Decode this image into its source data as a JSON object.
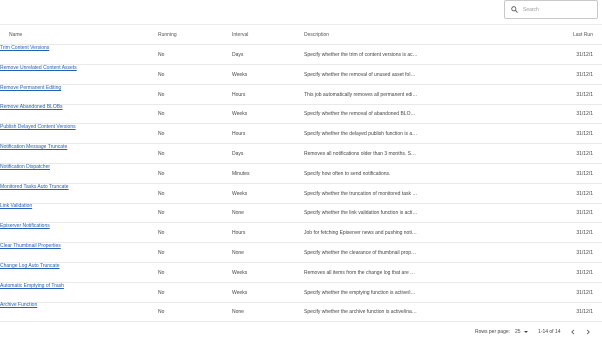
{
  "search": {
    "placeholder": "Search"
  },
  "table": {
    "headers": {
      "name": "Name",
      "running": "Running",
      "interval": "Interval",
      "description": "Description",
      "last_run": "Last Run"
    },
    "rows": [
      {
        "name": "Trim Content Versions",
        "running": "No",
        "interval": "Days",
        "description": "Specify whether the trim of content versions is activ…",
        "last_run": "31/12/1"
      },
      {
        "name": "Remove Unrelated Content Assets",
        "running": "No",
        "interval": "Weeks",
        "description": "Specify whether the removal of unused asset folders …",
        "last_run": "31/12/1"
      },
      {
        "name": "Remove Permanent Editing",
        "running": "No",
        "interval": "Hours",
        "description": "This job automatically removes all permanent editing…",
        "last_run": "31/12/1"
      },
      {
        "name": "Remove Abandoned BLOBs",
        "running": "No",
        "interval": "Weeks",
        "description": "Specify whether the removal of abandoned BLOBs is a…",
        "last_run": "31/12/1"
      },
      {
        "name": "Publish Delayed Content Versions",
        "running": "No",
        "interval": "Hours",
        "description": "Specify whether the delayed publish function is activ…",
        "last_run": "31/12/1"
      },
      {
        "name": "Notification Message Truncate",
        "running": "No",
        "interval": "Days",
        "description": "Removes all notifications older than 3 months. Speci…",
        "last_run": "31/12/1"
      },
      {
        "name": "Notification Dispatcher",
        "running": "No",
        "interval": "Minutes",
        "description": "Specify how often to send notifications.",
        "last_run": "31/12/1"
      },
      {
        "name": "Monitored Tasks Auto Truncate",
        "running": "No",
        "interval": "Weeks",
        "description": "Specify whether the truncation of monitored task inf…",
        "last_run": "31/12/1"
      },
      {
        "name": "Link Validation",
        "running": "No",
        "interval": "None",
        "description": "Specify whether the link validation function is activ…",
        "last_run": "31/12/1"
      },
      {
        "name": "Episerver Notifications",
        "running": "No",
        "interval": "Hours",
        "description": "Job for fetching Episerver news and pushing notifica…",
        "last_run": "31/12/1"
      },
      {
        "name": "Clear Thumbnail Properties",
        "running": "No",
        "interval": "None",
        "description": "Specify whether the clearance of thumbnail properti…",
        "last_run": "31/12/1"
      },
      {
        "name": "Change Log Auto Truncate",
        "running": "No",
        "interval": "Weeks",
        "description": "Removes all items from the change log that are more …",
        "last_run": "31/12/1"
      },
      {
        "name": "Automatic Emptying of Trash",
        "running": "No",
        "interval": "Weeks",
        "description": "Specify whether the emptying function is active/inac…",
        "last_run": "31/12/1"
      },
      {
        "name": "Archive Function",
        "running": "No",
        "interval": "None",
        "description": "Specify whether the archive function is active/inacti…",
        "last_run": "31/12/1"
      }
    ]
  },
  "pagination": {
    "rows_per_page_label": "Rows per page:",
    "rows_per_page_value": "25",
    "range_text": "1-14 of 14"
  },
  "icons": {
    "search": "search-icon",
    "prev": "chevron-left-icon",
    "next": "chevron-right-icon",
    "caret": "caret-down-icon"
  },
  "colors": {
    "link": "#2461b8",
    "border": "#e9e9e9"
  }
}
